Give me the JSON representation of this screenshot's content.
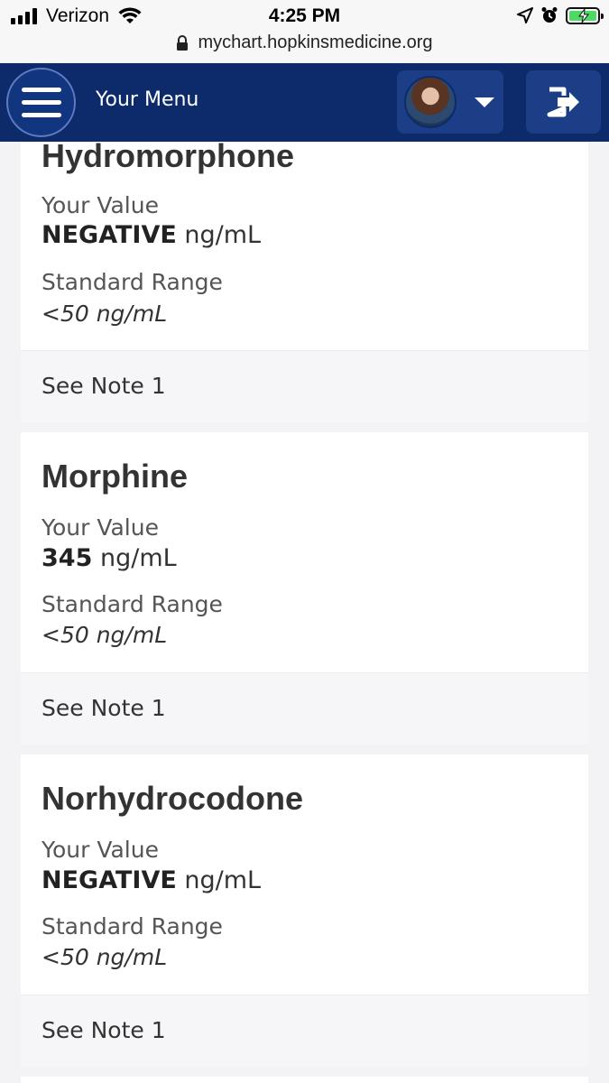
{
  "status_bar": {
    "carrier": "Verizon",
    "time": "4:25 PM"
  },
  "browser": {
    "url": "mychart.hopkinsmedicine.org"
  },
  "header": {
    "menu_label": "Your Menu"
  },
  "results": [
    {
      "name": "Hydromorphone",
      "value_label": "Your Value",
      "value": "NEGATIVE",
      "unit": "ng/mL",
      "range_label": "Standard Range",
      "range": "<50 ng/mL",
      "note": "See Note 1"
    },
    {
      "name": "Morphine",
      "value_label": "Your Value",
      "value": "345",
      "unit": "ng/mL",
      "range_label": "Standard Range",
      "range": "<50 ng/mL",
      "note": "See Note 1"
    },
    {
      "name": "Norhydrocodone",
      "value_label": "Your Value",
      "value": "NEGATIVE",
      "unit": "ng/mL",
      "range_label": "Standard Range",
      "range": "<50 ng/mL",
      "note": "See Note 1"
    }
  ],
  "colors": {
    "header_bg": "#0d2a6b",
    "button_bg": "#1c3e86",
    "page_bg": "#f3f3f6",
    "card_bg": "#ffffff"
  }
}
